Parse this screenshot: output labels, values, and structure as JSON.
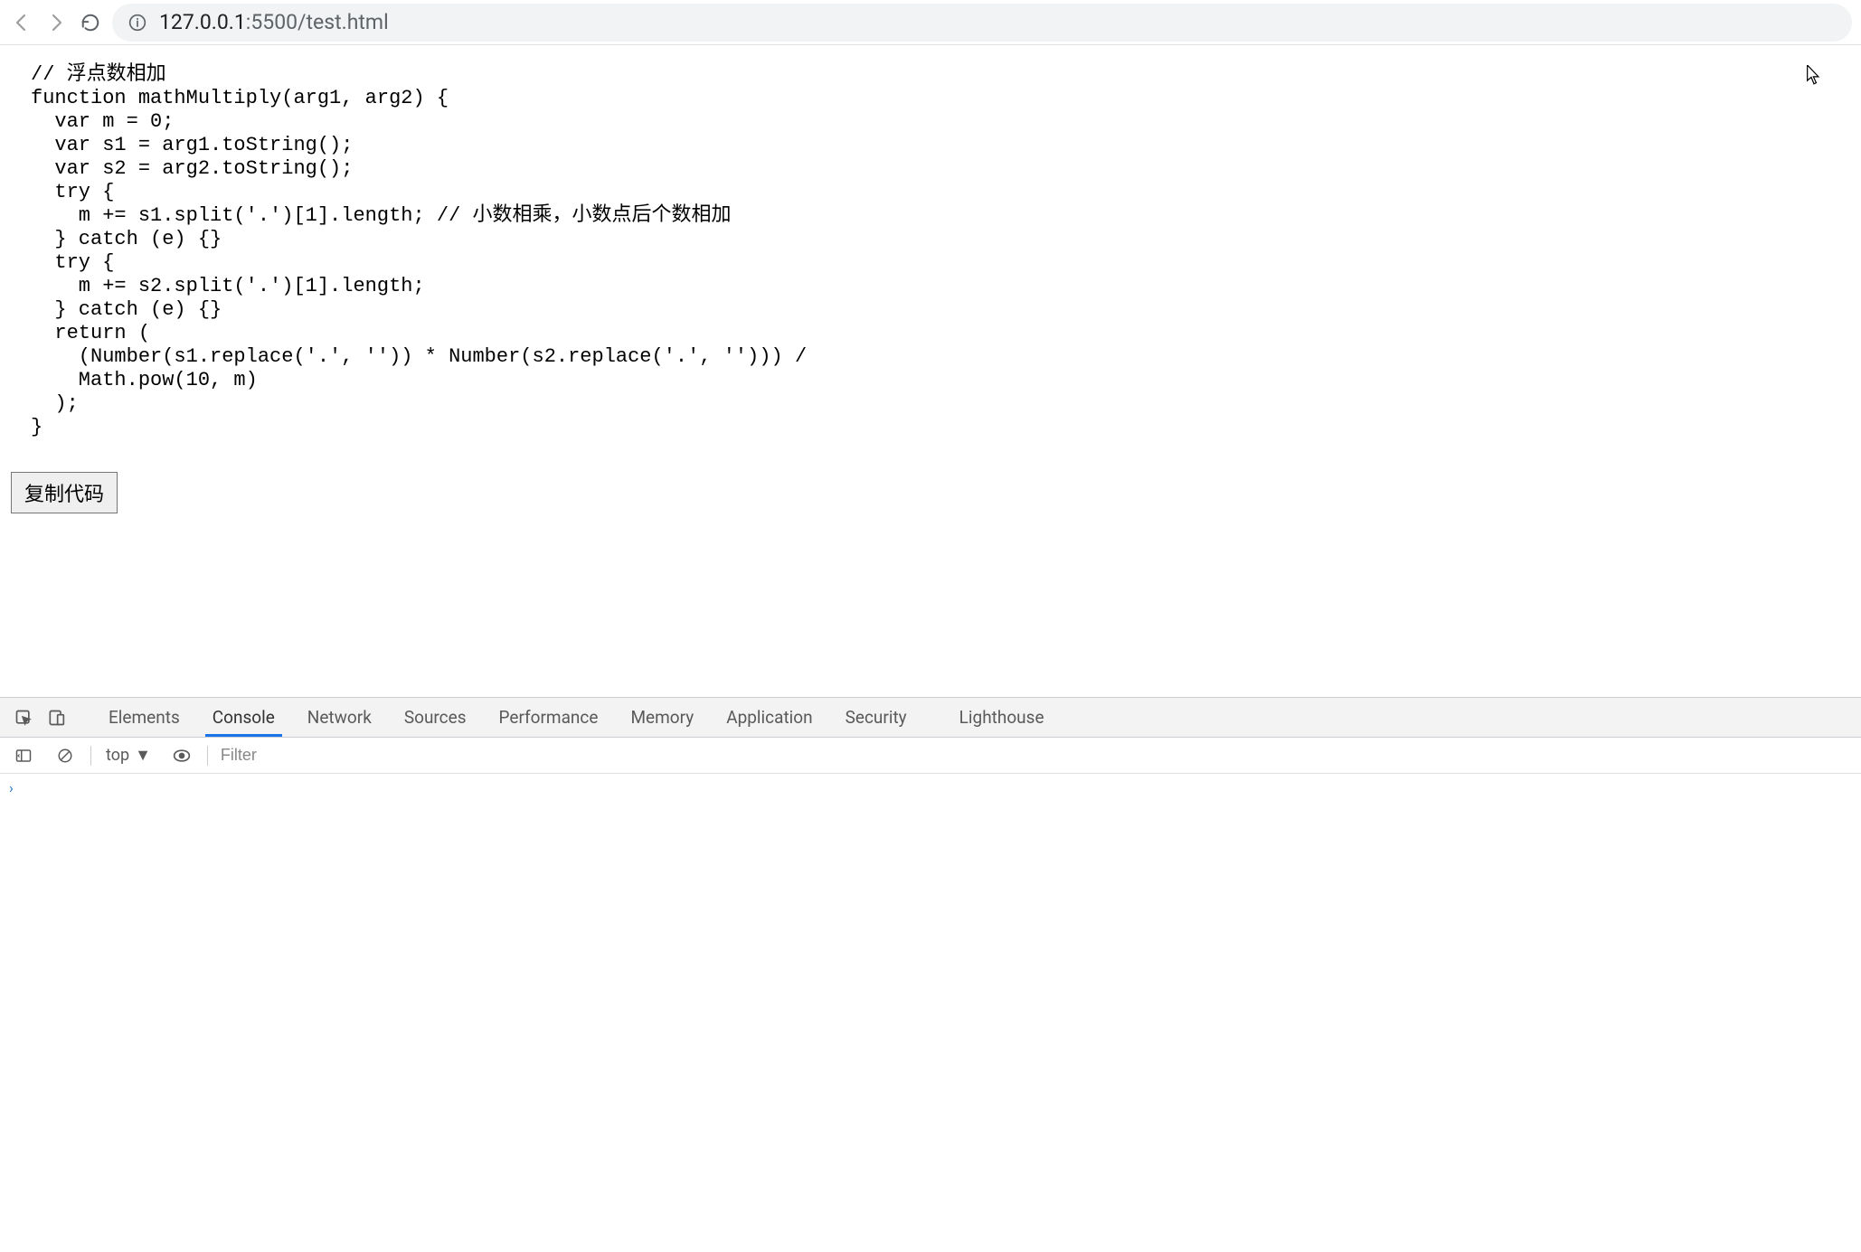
{
  "browser": {
    "url_host": "127.0.0.1",
    "url_port": ":5500",
    "url_path": "/test.html"
  },
  "page": {
    "code_lines": [
      "// 浮点数相加",
      "function mathMultiply(arg1, arg2) {",
      "  var m = 0;",
      "  var s1 = arg1.toString();",
      "  var s2 = arg2.toString();",
      "  try {",
      "    m += s1.split('.')[1].length; // 小数相乘，小数点后个数相加",
      "  } catch (e) {}",
      "  try {",
      "    m += s2.split('.')[1].length;",
      "  } catch (e) {}",
      "  return (",
      "    (Number(s1.replace('.', '')) * Number(s2.replace('.', ''))) /",
      "    Math.pow(10, m)",
      "  );",
      "}"
    ],
    "copy_button": "复制代码"
  },
  "devtools": {
    "tabs": {
      "elements": "Elements",
      "console": "Console",
      "network": "Network",
      "sources": "Sources",
      "performance": "Performance",
      "memory": "Memory",
      "application": "Application",
      "security": "Security",
      "lighthouse": "Lighthouse"
    },
    "context_label": "top",
    "filter_placeholder": "Filter",
    "prompt": "›"
  }
}
